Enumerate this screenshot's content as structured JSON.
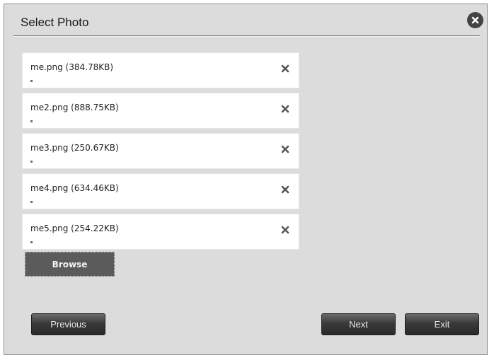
{
  "dialog": {
    "title": "Select Photo",
    "close_icon": "close-circle-icon"
  },
  "files": [
    {
      "label": "me.png (384.78KB)",
      "progress": 0.01,
      "remove_icon": "x-icon"
    },
    {
      "label": "me2.png (888.75KB)",
      "progress": 0.01,
      "remove_icon": "x-icon"
    },
    {
      "label": "me3.png (250.67KB)",
      "progress": 0.01,
      "remove_icon": "x-icon"
    },
    {
      "label": "me4.png (634.46KB)",
      "progress": 0.01,
      "remove_icon": "x-icon"
    },
    {
      "label": "me5.png (254.22KB)",
      "progress": 0.01,
      "remove_icon": "x-icon"
    }
  ],
  "browse_label": "Browse",
  "buttons": {
    "previous": "Previous",
    "next": "Next",
    "exit": "Exit"
  },
  "colors": {
    "dialog_bg": "#dcdcdc",
    "button_dark": "#3a3a3a"
  }
}
